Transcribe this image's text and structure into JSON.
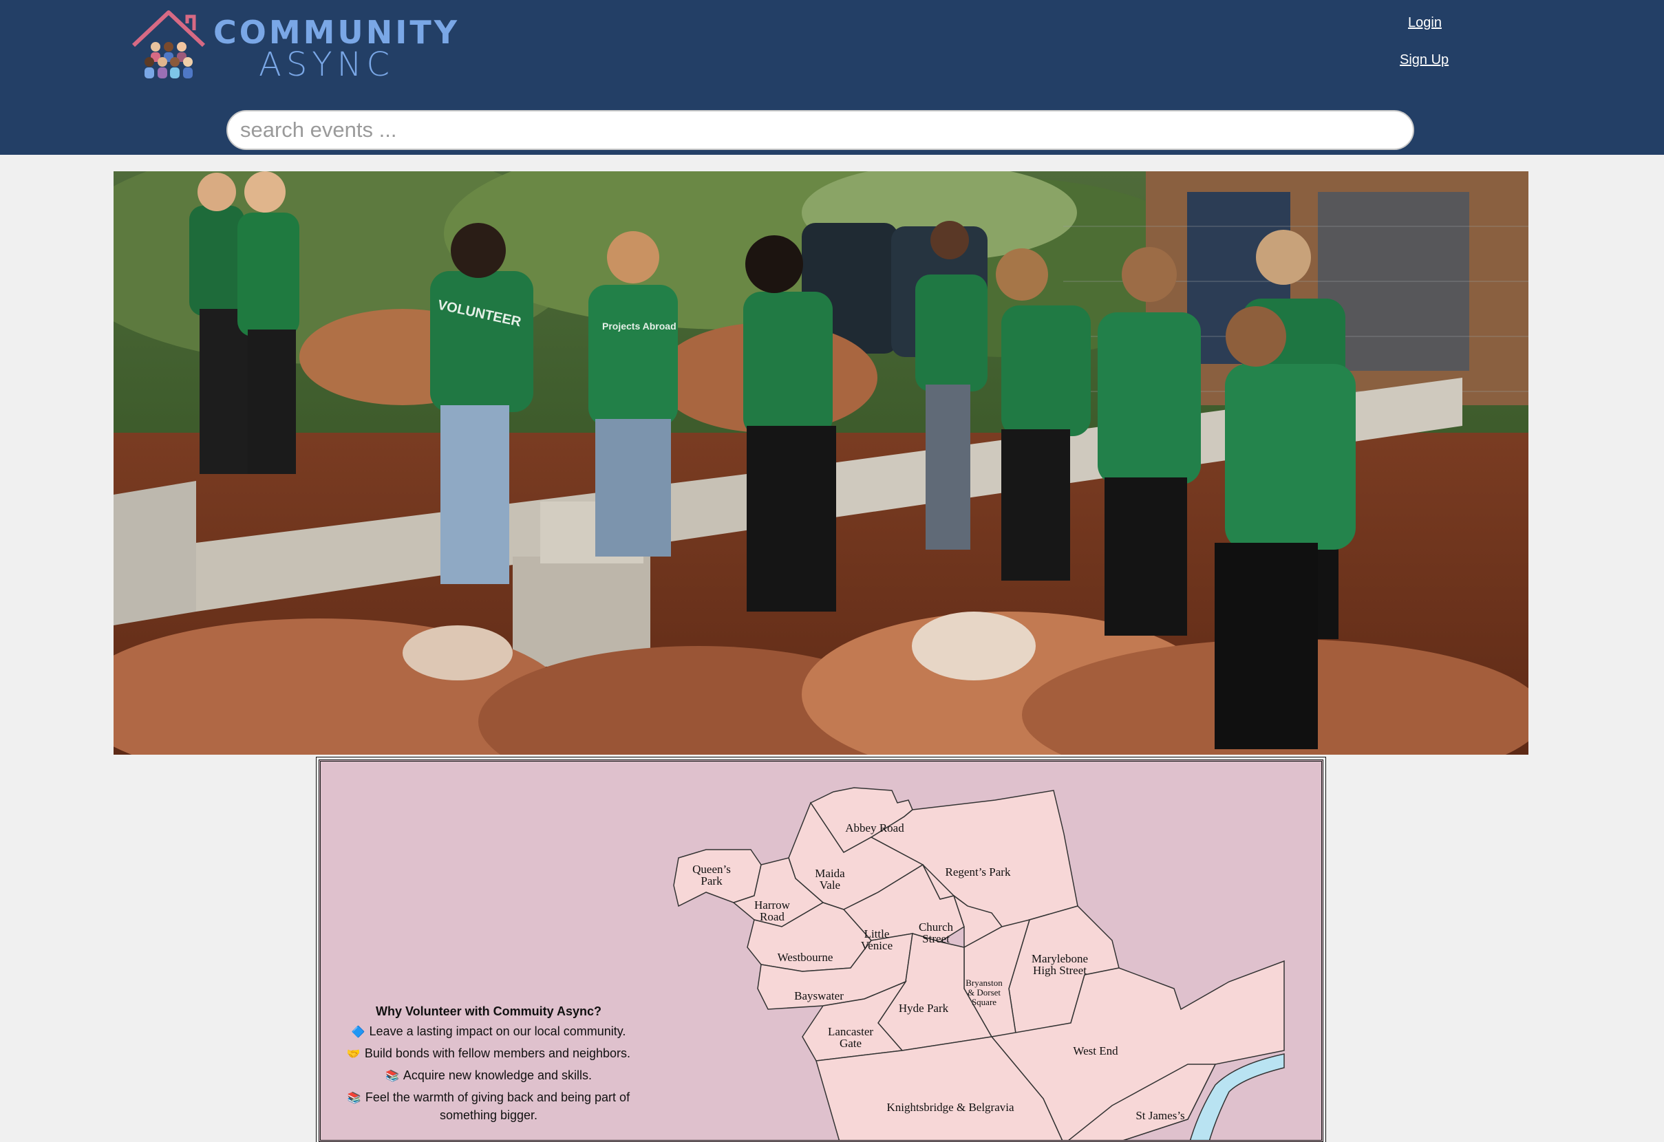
{
  "header": {
    "logo": {
      "line1": "COMMUNITY",
      "line2": "ASYNC"
    },
    "login_label": "Login",
    "signup_label": "Sign Up",
    "search_placeholder": "search events ..."
  },
  "hero": {
    "shirt_text": [
      "VOLUNTEER",
      "Projects Abroad"
    ]
  },
  "map": {
    "districts": [
      "Abbey Road",
      "Queen’s Park",
      "Maida Vale",
      "Regent’s Park",
      "Harrow Road",
      "Little Venice",
      "Church Street",
      "Westbourne",
      "Marylebone High Street",
      "Bryanston & Dorset Square",
      "Bayswater",
      "Hyde Park",
      "Lancaster Gate",
      "West End",
      "Knightsbridge & Belgravia",
      "St James’s"
    ]
  },
  "why": {
    "title": "Why Volunteer with Commuity Async?",
    "items": [
      {
        "icon": "diamond-icon",
        "glyph": "🔷",
        "text": "Leave a lasting impact on our local community."
      },
      {
        "icon": "handshake-icon",
        "glyph": "🤝",
        "text": "Build bonds with fellow members and neighbors."
      },
      {
        "icon": "books-icon",
        "glyph": "📚",
        "text": "Acquire new knowledge and skills."
      },
      {
        "icon": "books-icon",
        "glyph": "📚",
        "text": "Feel the warmth of giving back and being part of something bigger."
      }
    ]
  },
  "colors": {
    "header_bg": "#233f66",
    "logo_blue": "#7aa7e6",
    "map_bg": "#dfc1cd",
    "district_fill": "#f7d7d7",
    "river": "#b9e3f2"
  }
}
